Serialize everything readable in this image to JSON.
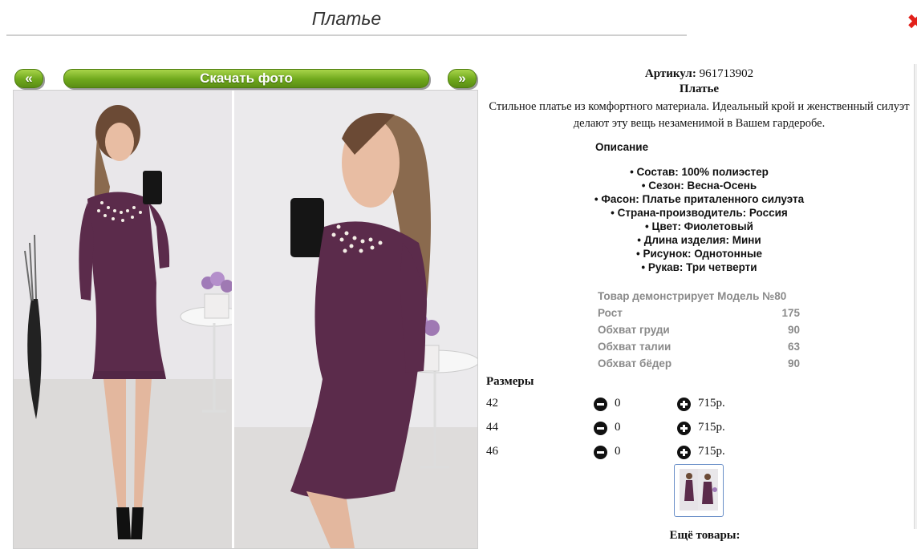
{
  "page": {
    "title": "Платье"
  },
  "nav": {
    "prev_label": "«",
    "download_label": "Скачать фото",
    "next_label": "»"
  },
  "product": {
    "sku_label": "Артикул:",
    "sku_value": "961713902",
    "name": "Платье",
    "description": "Стильное платье из комфортного материала. Идеальный крой и женственный силуэт делают эту вещь незаменимой в Вашем гардеробе."
  },
  "details": {
    "heading": "Описание",
    "items": [
      "Состав: 100% полиэстер",
      "Сезон: Весна-Осень",
      "Фасон: Платье приталенного силуэта",
      "Страна-производитель: Россия",
      "Цвет: Фиолетовый",
      "Длина изделия: Мини",
      "Рисунок: Однотонные",
      "Рукав: Три четверти"
    ]
  },
  "model": {
    "rows": [
      {
        "label": "Товар демонстрирует Модель №80",
        "value": ""
      },
      {
        "label": "Рост",
        "value": "175"
      },
      {
        "label": "Обхват груди",
        "value": "90"
      },
      {
        "label": "Обхват талии",
        "value": "63"
      },
      {
        "label": "Обхват бёдер",
        "value": "90"
      }
    ]
  },
  "sizes": {
    "heading": "Размеры",
    "rows": [
      {
        "size": "42",
        "qty": "0",
        "price": "715р."
      },
      {
        "size": "44",
        "qty": "0",
        "price": "715р."
      },
      {
        "size": "46",
        "qty": "0",
        "price": "715р."
      }
    ]
  },
  "more": {
    "heading": "Ещё товары:"
  },
  "colors": {
    "accent_green": "#6fa81c",
    "dress_purple": "#5b2b4b",
    "close_red": "#e2201a"
  },
  "icons": [
    "close-icon",
    "minus-icon",
    "plus-icon"
  ]
}
